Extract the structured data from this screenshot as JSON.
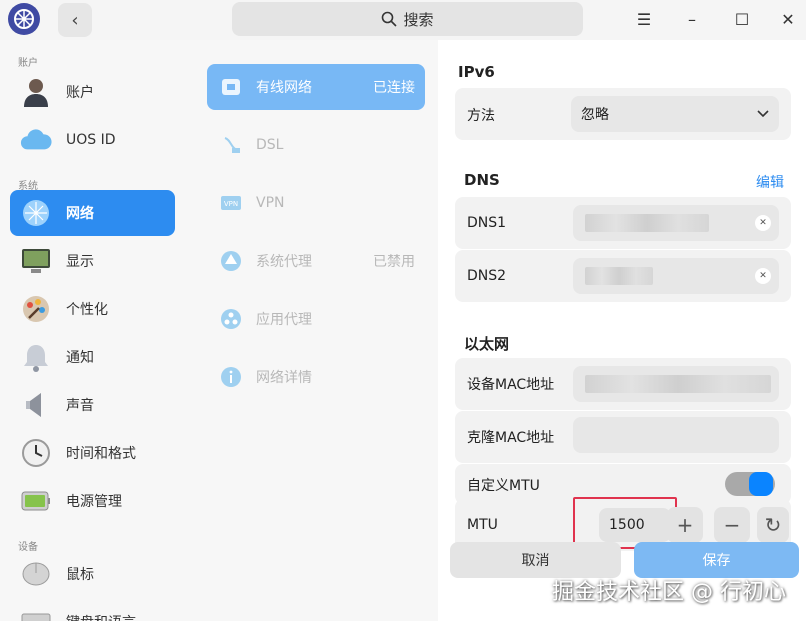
{
  "search": {
    "label": "搜索"
  },
  "window": {
    "menu_glyph": "☰",
    "minimize_glyph": "–",
    "maximize_glyph": "☐",
    "close_glyph": "✕",
    "back_glyph": "‹"
  },
  "sidebar": {
    "groups": {
      "account": "账户",
      "system": "系统",
      "device": "设备"
    },
    "items": [
      {
        "label": "账户",
        "icon": "account-icon"
      },
      {
        "label": "UOS ID",
        "icon": "cloud-icon"
      },
      {
        "label": "网络",
        "icon": "network-icon",
        "active": true
      },
      {
        "label": "显示",
        "icon": "display-icon"
      },
      {
        "label": "个性化",
        "icon": "personalization-icon"
      },
      {
        "label": "通知",
        "icon": "bell-icon"
      },
      {
        "label": "声音",
        "icon": "speaker-icon"
      },
      {
        "label": "时间和格式",
        "icon": "clock-icon"
      },
      {
        "label": "电源管理",
        "icon": "battery-icon"
      },
      {
        "label": "鼠标",
        "icon": "mouse-icon"
      },
      {
        "label": "键盘和语言",
        "icon": "keyboard-icon"
      }
    ]
  },
  "network_menu": {
    "items": [
      {
        "label": "有线网络",
        "state": "已连接",
        "icon": "wired-icon",
        "active": true
      },
      {
        "label": "DSL",
        "state": "",
        "icon": "dsl-icon"
      },
      {
        "label": "VPN",
        "state": "",
        "icon": "vpn-icon"
      },
      {
        "label": "系统代理",
        "state": "已禁用",
        "icon": "proxy-icon"
      },
      {
        "label": "应用代理",
        "state": "",
        "icon": "app-proxy-icon"
      },
      {
        "label": "网络详情",
        "state": "",
        "icon": "info-icon"
      }
    ]
  },
  "panel": {
    "ipv6": {
      "title": "IPv6",
      "method_label": "方法",
      "method_value": "忽略"
    },
    "dns": {
      "title": "DNS",
      "edit": "编辑",
      "dns1_label": "DNS1",
      "dns2_label": "DNS2"
    },
    "ethernet": {
      "title": "以太网",
      "mac_label": "设备MAC地址",
      "clone_mac_label": "克隆MAC地址",
      "custom_mtu_label": "自定义MTU",
      "custom_mtu_enabled": true,
      "mtu_label": "MTU",
      "mtu_value": "1500",
      "plus": "+",
      "minus": "−",
      "reset": "↻"
    }
  },
  "buttons": {
    "cancel": "取消",
    "save": "保存"
  },
  "watermark": "掘金技术社区 @ 行初心",
  "colors": {
    "accent": "#2d8cf0",
    "active_light": "#78b8f5",
    "toggle": "#0a84ff",
    "highlight": "#e0334e"
  }
}
